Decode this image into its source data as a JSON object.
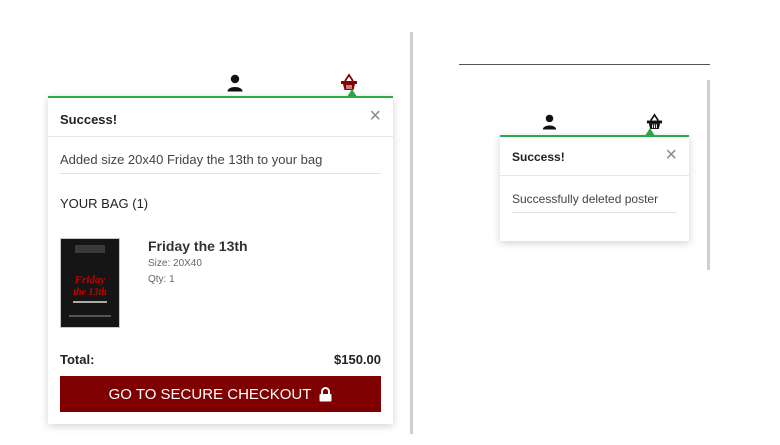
{
  "left_panel": {
    "toast": {
      "title": "Success!",
      "close_glyph": "×",
      "message": "Added size 20x40 Friday the 13th to your bag",
      "bag_title": "YOUR BAG (1)",
      "item": {
        "name": "Friday the 13th",
        "size": "Size: 20X40",
        "qty": "Qty: 1"
      },
      "total_label": "Total:",
      "total_value": "$150.00",
      "checkout_label": "GO TO SECURE CHECKOUT",
      "checkout_icon": "lock-icon"
    },
    "nav_icons": [
      "user-icon",
      "basket-icon"
    ],
    "basket_color": "#8b0000"
  },
  "right_panel": {
    "toast": {
      "title": "Success!",
      "close_glyph": "×",
      "message": "Successfully deleted poster"
    },
    "nav_icons": [
      "user-icon",
      "basket-icon"
    ]
  },
  "colors": {
    "success_accent": "#2ea84a",
    "checkout_bg": "#7f0000"
  }
}
